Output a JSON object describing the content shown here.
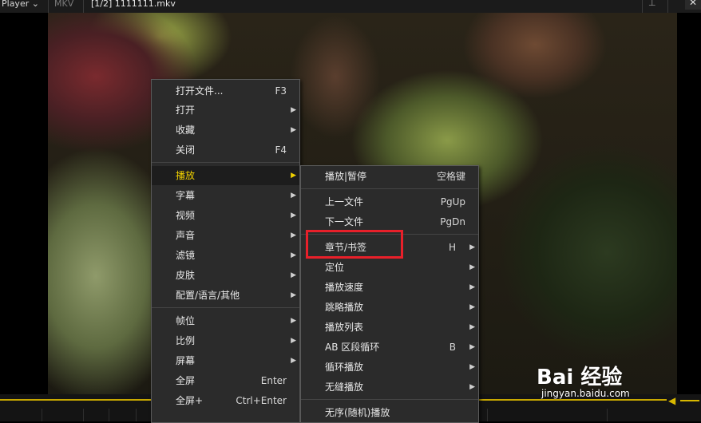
{
  "titlebar": {
    "app_name": "Player ⌄",
    "format": "MKV",
    "file_title": "[1/2] 1111111.mkv",
    "pin_icon": "pin-icon",
    "close_label": "✕"
  },
  "main_menu": {
    "items": [
      {
        "label": "打开文件...",
        "shortcut": "F3",
        "submenu": false
      },
      {
        "label": "打开",
        "shortcut": "",
        "submenu": true
      },
      {
        "label": "收藏",
        "shortcut": "",
        "submenu": true
      },
      {
        "label": "关闭",
        "shortcut": "F4",
        "submenu": false
      },
      {
        "label": "播放",
        "shortcut": "",
        "submenu": true,
        "highlighted": true
      },
      {
        "label": "字幕",
        "shortcut": "",
        "submenu": true
      },
      {
        "label": "视频",
        "shortcut": "",
        "submenu": true
      },
      {
        "label": "声音",
        "shortcut": "",
        "submenu": true
      },
      {
        "label": "滤镜",
        "shortcut": "",
        "submenu": true
      },
      {
        "label": "皮肤",
        "shortcut": "",
        "submenu": true
      },
      {
        "label": "配置/语言/其他",
        "shortcut": "",
        "submenu": true
      },
      {
        "label": "帧位",
        "shortcut": "",
        "submenu": true
      },
      {
        "label": "比例",
        "shortcut": "",
        "submenu": true
      },
      {
        "label": "屏幕",
        "shortcut": "",
        "submenu": true
      },
      {
        "label": "全屏",
        "shortcut": "Enter",
        "submenu": false
      },
      {
        "label": "全屏+",
        "shortcut": "Ctrl+Enter",
        "submenu": false
      }
    ]
  },
  "play_submenu": {
    "items": [
      {
        "label": "播放|暂停",
        "shortcut": "空格键",
        "submenu": false
      },
      {
        "label": "上一文件",
        "shortcut": "PgUp",
        "submenu": false
      },
      {
        "label": "下一文件",
        "shortcut": "PgDn",
        "submenu": false
      },
      {
        "label": "章节/书签",
        "shortcut": "H",
        "submenu": true
      },
      {
        "label": "定位",
        "shortcut": "",
        "submenu": true
      },
      {
        "label": "播放速度",
        "shortcut": "",
        "submenu": true
      },
      {
        "label": "跳略播放",
        "shortcut": "",
        "submenu": true
      },
      {
        "label": "播放列表",
        "shortcut": "",
        "submenu": true
      },
      {
        "label": "AB 区段循环",
        "shortcut": "B",
        "submenu": true
      },
      {
        "label": "循环播放",
        "shortcut": "",
        "submenu": true
      },
      {
        "label": "无缝播放",
        "shortcut": "",
        "submenu": true
      },
      {
        "label": "无序(随机)播放",
        "shortcut": "",
        "submenu": false
      }
    ]
  },
  "arrow_glyph": "▶",
  "watermark": {
    "logo_text": "Bai 经验",
    "url": "jingyan.baidu.com"
  },
  "colors": {
    "highlight": "#f0d000",
    "accent_bar": "#c8a800",
    "annotation_box": "#e8202a"
  }
}
